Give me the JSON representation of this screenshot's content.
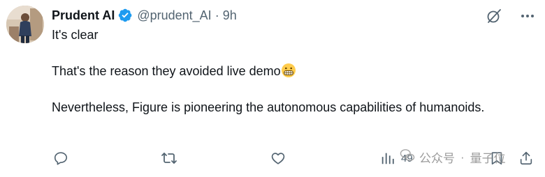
{
  "author": {
    "display_name": "Prudent AI",
    "handle": "@prudent_AI",
    "separator": "·",
    "time": "9h",
    "verified": true,
    "avatar_icon": "profile-photo"
  },
  "tweet": {
    "lines": [
      "It's clear",
      "That's the reason they avoided live demo",
      "Nevertheless, Figure is pioneering the autonomous capabilities of humanoids."
    ],
    "emoji": "grimacing-face"
  },
  "actions": {
    "reply_icon": "reply-icon",
    "retweet_icon": "retweet-icon",
    "like_icon": "heart-icon",
    "views_icon": "views-chart-icon",
    "views_count": "49",
    "bookmark_icon": "bookmark-icon",
    "share_icon": "share-icon"
  },
  "header_icons": {
    "grok": "grok-icon",
    "more": "more-icon"
  },
  "watermark": {
    "text1": "公众号",
    "sep": "·",
    "text2": "量子位"
  },
  "colors": {
    "text_primary": "#0f1419",
    "text_secondary": "#536471",
    "verified_blue": "#1d9bf0",
    "background": "#ffffff"
  }
}
